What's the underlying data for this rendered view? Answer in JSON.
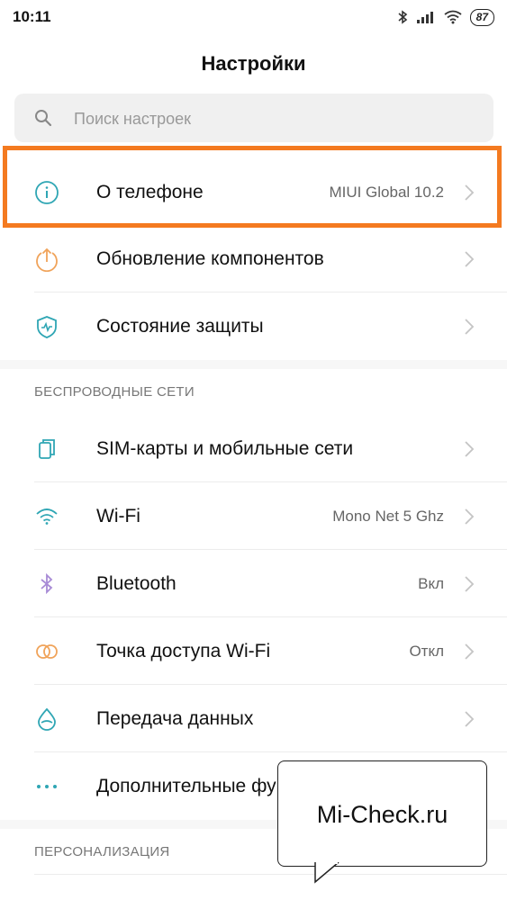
{
  "status_bar": {
    "time": "10:11",
    "battery": "87"
  },
  "header": {
    "title": "Настройки"
  },
  "search": {
    "placeholder": "Поиск настроек"
  },
  "rows": [
    {
      "label": "О телефоне",
      "value": "MIUI Global 10.2",
      "icon": "info-icon"
    },
    {
      "label": "Обновление компонентов",
      "value": "",
      "icon": "update-icon"
    },
    {
      "label": "Состояние защиты",
      "value": "",
      "icon": "shield-icon"
    }
  ],
  "sections": [
    {
      "header": "БЕСПРОВОДНЫЕ СЕТИ",
      "rows": [
        {
          "label": "SIM-карты и мобильные сети",
          "value": "",
          "icon": "sim-icon"
        },
        {
          "label": "Wi-Fi",
          "value": "Mono Net 5 Ghz",
          "icon": "wifi-icon"
        },
        {
          "label": "Bluetooth",
          "value": "Вкл",
          "icon": "bluetooth-icon"
        },
        {
          "label": "Точка доступа Wi-Fi",
          "value": "Откл",
          "icon": "hotspot-icon"
        },
        {
          "label": "Передача данных",
          "value": "",
          "icon": "data-usage-icon"
        },
        {
          "label": "Дополнительные функции",
          "value": "",
          "icon": "more-dots-icon"
        }
      ]
    },
    {
      "header": "ПЕРСОНАЛИЗАЦИЯ",
      "rows": []
    }
  ],
  "annotation": {
    "callout_text": "Mi-Check.ru",
    "highlight_color": "#f47a20"
  },
  "colors": {
    "teal": "#2fa6b4",
    "orange": "#f0a35a",
    "purple": "#a88bd6"
  }
}
